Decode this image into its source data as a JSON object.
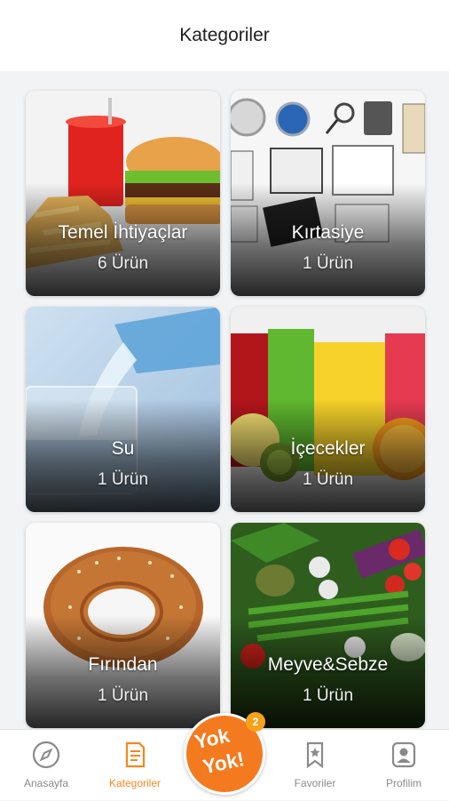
{
  "header": {
    "title": "Kategoriler"
  },
  "categories": [
    {
      "name": "Temel İhtiyaçlar",
      "count": "6 Ürün",
      "icon": "burger-fries-drink-image"
    },
    {
      "name": "Kırtasiye",
      "count": "1 Ürün",
      "icon": "stationery-image"
    },
    {
      "name": "Su",
      "count": "1 Ürün",
      "icon": "water-pouring-image"
    },
    {
      "name": "İçecekler",
      "count": "1 Ürün",
      "icon": "juice-glasses-image"
    },
    {
      "name": "Fırından",
      "count": "1 Ürün",
      "icon": "simit-image"
    },
    {
      "name": "Meyve&Sebze",
      "count": "1 Ürün",
      "icon": "vegetables-image"
    }
  ],
  "tabbar": {
    "home": "Anasayfa",
    "categories": "Kategoriler",
    "logo": "Yok Yok!",
    "badge": "2",
    "favorites": "Favoriler",
    "profile": "Profilim"
  },
  "colors": {
    "accent": "#f5871f",
    "inactive": "#8a8a8a",
    "logo_bg": "#f47a20"
  }
}
